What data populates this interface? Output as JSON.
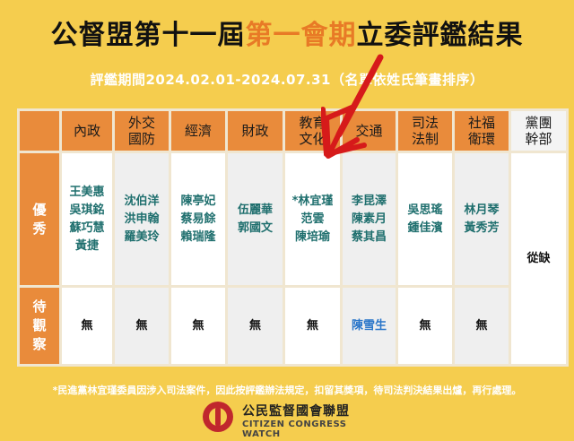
{
  "title": {
    "part1": "公督盟第十一屆",
    "highlight": "第一會期",
    "part2": "立委評鑑結果"
  },
  "period": "評鑑期間2024.02.01-2024.07.31（名單依姓氏筆畫排序）",
  "columns": [
    "內政",
    "外交\n國防",
    "經濟",
    "財政",
    "教育\n文化",
    "交通",
    "司法\n法制",
    "社福\n衛環",
    "黨團\n幹部"
  ],
  "row_headers": {
    "excellent": "優\n秀",
    "watch": "待\n觀\n察"
  },
  "excellent": [
    "王美惠\n吳琪銘\n蘇巧慧\n黃捷",
    "沈伯洋\n洪申翰\n羅美玲",
    "陳亭妃\n蔡易餘\n賴瑞隆",
    "伍麗華\n郭國文",
    "*林宜瑾\n范雲\n陳培瑜",
    "李昆澤\n陳素月\n蔡其昌",
    "吳思瑤\n鍾佳濱",
    "林月琴\n黃秀芳",
    "從缺"
  ],
  "watch": [
    "無",
    "無",
    "無",
    "無",
    "無",
    "陳雪生",
    "無",
    "無"
  ],
  "footnote": "*民進黨林宜瑾委員因涉入司法案件，因此按評鑑辦法規定，扣留其獎項，待司法判決結果出爐，再行處理。",
  "logo": {
    "cn": "公民監督國會聯盟",
    "en": "CITIZEN CONGRESS WATCH"
  },
  "colors": {
    "background": "#f5cd4e",
    "header": "#e98b3b",
    "title_highlight": "#e87a26",
    "name_text": "#1f6f6e",
    "arrow": "#d61a1a",
    "watch_name": "#2a76c9"
  }
}
